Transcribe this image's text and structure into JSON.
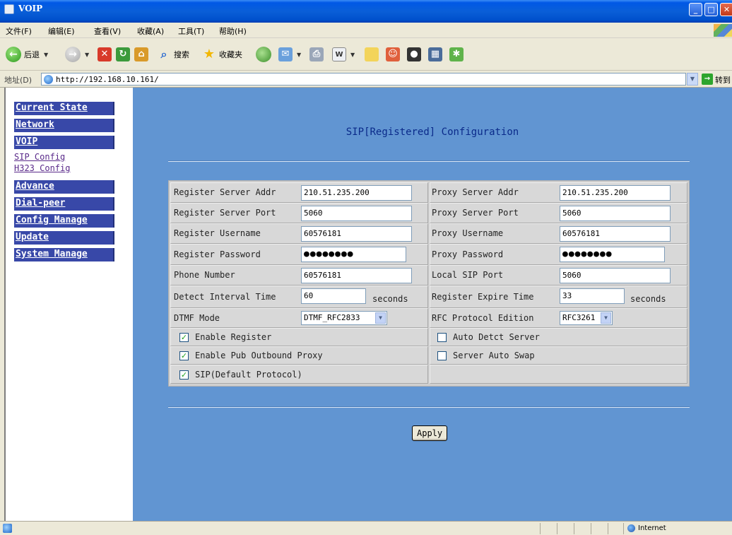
{
  "window": {
    "title": "VOIP"
  },
  "menu": [
    "文件(F)",
    "编辑(E)",
    "查看(V)",
    "收藏(A)",
    "工具(T)",
    "帮助(H)"
  ],
  "toolbar": {
    "back": "后退",
    "search": "搜索",
    "favorites": "收藏夹"
  },
  "address": {
    "label": "地址(D)",
    "url": "http://192.168.10.161/",
    "go": "转到"
  },
  "sidebar": {
    "current_state": "Current State",
    "network": "Network",
    "voip": "VOIP",
    "sip_config": "SIP Config",
    "h323_config": "H323 Config",
    "advance": "Advance",
    "dial_peer": "Dial-peer",
    "config_manage": "Config Manage",
    "update": "Update",
    "system_manage": "System Manage"
  },
  "page": {
    "title": "SIP[Registered] Configuration"
  },
  "form": {
    "register_server_addr": {
      "label": "Register Server Addr",
      "value": "210.51.235.200"
    },
    "proxy_server_addr": {
      "label": "Proxy Server Addr",
      "value": "210.51.235.200"
    },
    "register_server_port": {
      "label": "Register Server Port",
      "value": "5060"
    },
    "proxy_server_port": {
      "label": "Proxy Server Port",
      "value": "5060"
    },
    "register_username": {
      "label": "Register Username",
      "value": "60576181"
    },
    "proxy_username": {
      "label": "Proxy Username",
      "value": "60576181"
    },
    "register_password": {
      "label": "Register Password",
      "value": "●●●●●●●●"
    },
    "proxy_password": {
      "label": "Proxy Password",
      "value": "●●●●●●●●"
    },
    "phone_number": {
      "label": "Phone Number",
      "value": "60576181"
    },
    "local_sip_port": {
      "label": "Local SIP Port",
      "value": "5060"
    },
    "detect_interval": {
      "label": "Detect Interval Time",
      "value": "60",
      "unit": "seconds"
    },
    "register_expire": {
      "label": "Register Expire Time",
      "value": "33",
      "unit": "seconds"
    },
    "dtmf_mode": {
      "label": "DTMF Mode",
      "value": "DTMF_RFC2833"
    },
    "rfc_edition": {
      "label": "RFC Protocol Edition",
      "value": "RFC3261"
    },
    "enable_register": {
      "label": "Enable Register",
      "checked": true
    },
    "auto_detect_server": {
      "label": "Auto Detct Server",
      "checked": false
    },
    "enable_pub_outbound_proxy": {
      "label": "Enable Pub Outbound Proxy",
      "checked": true
    },
    "server_auto_swap": {
      "label": "Server Auto Swap",
      "checked": false
    },
    "sip_default_protocol": {
      "label": "SIP(Default Protocol)",
      "checked": true
    }
  },
  "apply_label": "Apply",
  "statusbar": {
    "zone": "Internet"
  }
}
